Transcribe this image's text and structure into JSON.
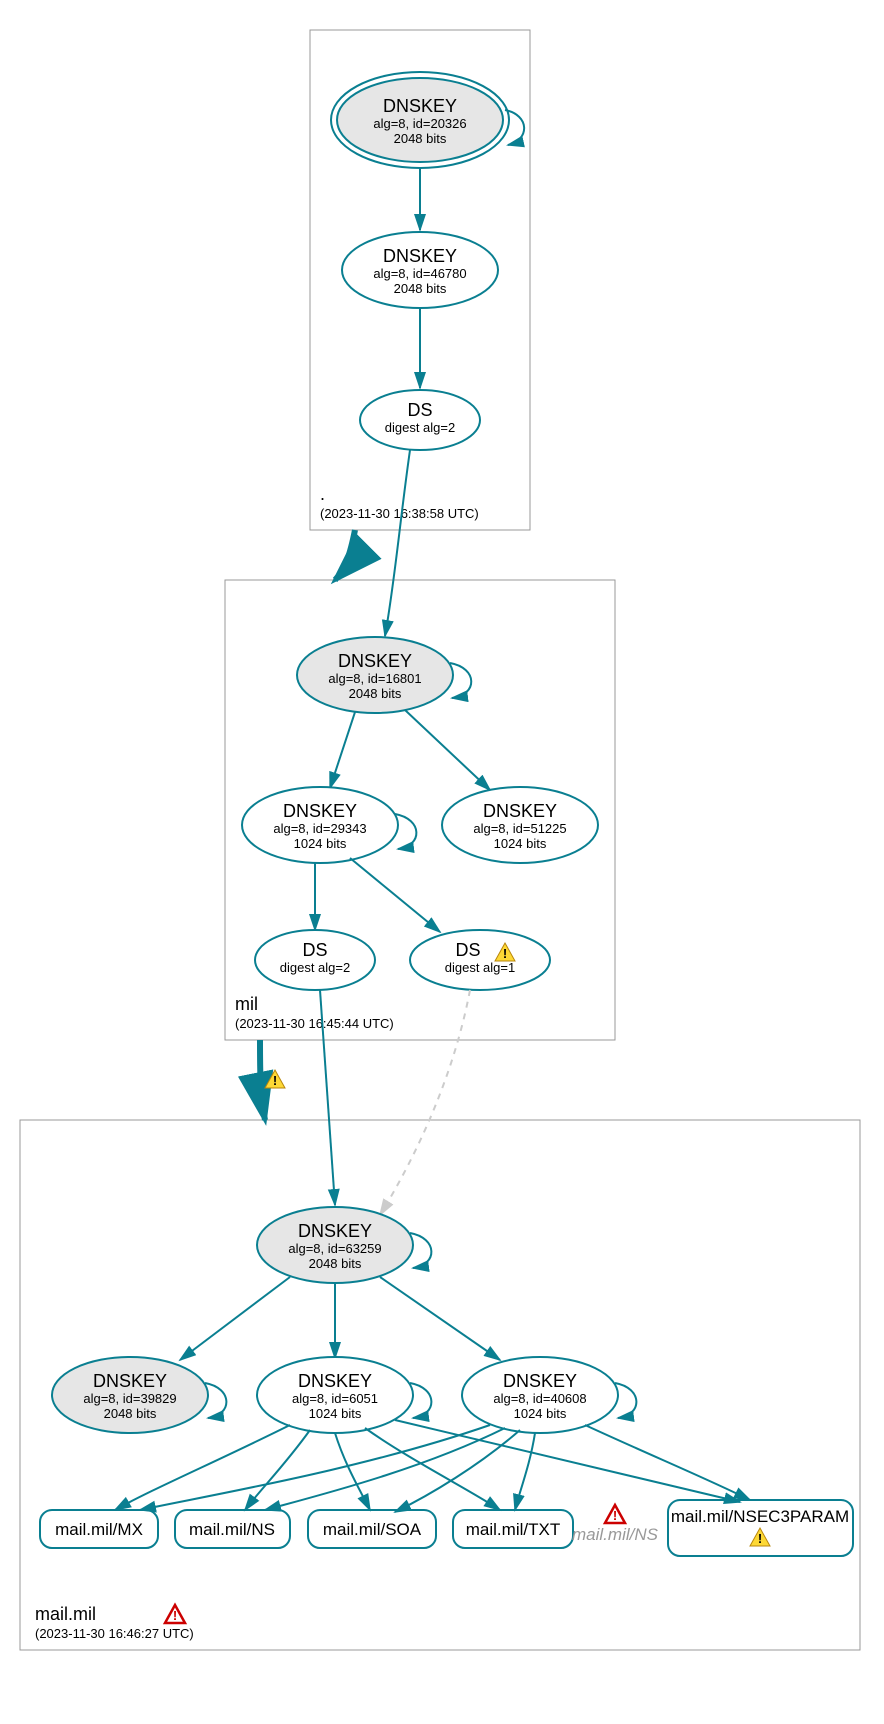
{
  "zones": {
    "root": {
      "name": ".",
      "time": "(2023-11-30 16:38:58 UTC)"
    },
    "mil": {
      "name": "mil",
      "time": "(2023-11-30 16:45:44 UTC)"
    },
    "mail": {
      "name": "mail.mil",
      "time": "(2023-11-30 16:46:27 UTC)"
    }
  },
  "nodes": {
    "root_ksk": {
      "t": "DNSKEY",
      "s1": "alg=8, id=20326",
      "s2": "2048 bits"
    },
    "root_zsk": {
      "t": "DNSKEY",
      "s1": "alg=8, id=46780",
      "s2": "2048 bits"
    },
    "root_ds": {
      "t": "DS",
      "s1": "digest alg=2",
      "s2": ""
    },
    "mil_ksk": {
      "t": "DNSKEY",
      "s1": "alg=8, id=16801",
      "s2": "2048 bits"
    },
    "mil_zsk1": {
      "t": "DNSKEY",
      "s1": "alg=8, id=29343",
      "s2": "1024 bits"
    },
    "mil_zsk2": {
      "t": "DNSKEY",
      "s1": "alg=8, id=51225",
      "s2": "1024 bits"
    },
    "mil_ds1": {
      "t": "DS",
      "s1": "digest alg=2",
      "s2": ""
    },
    "mil_ds2": {
      "t": "DS",
      "s1": "digest alg=1",
      "s2": ""
    },
    "mail_ksk": {
      "t": "DNSKEY",
      "s1": "alg=8, id=63259",
      "s2": "2048 bits"
    },
    "mail_k2": {
      "t": "DNSKEY",
      "s1": "alg=8, id=39829",
      "s2": "2048 bits"
    },
    "mail_k3": {
      "t": "DNSKEY",
      "s1": "alg=8, id=6051",
      "s2": "1024 bits"
    },
    "mail_k4": {
      "t": "DNSKEY",
      "s1": "alg=8, id=40608",
      "s2": "1024 bits"
    }
  },
  "rr": {
    "mx": "mail.mil/MX",
    "ns": "mail.mil/NS",
    "soa": "mail.mil/SOA",
    "txt": "mail.mil/TXT",
    "ns2": "mail.mil/NS",
    "np": "mail.mil/NSEC3PARAM"
  }
}
